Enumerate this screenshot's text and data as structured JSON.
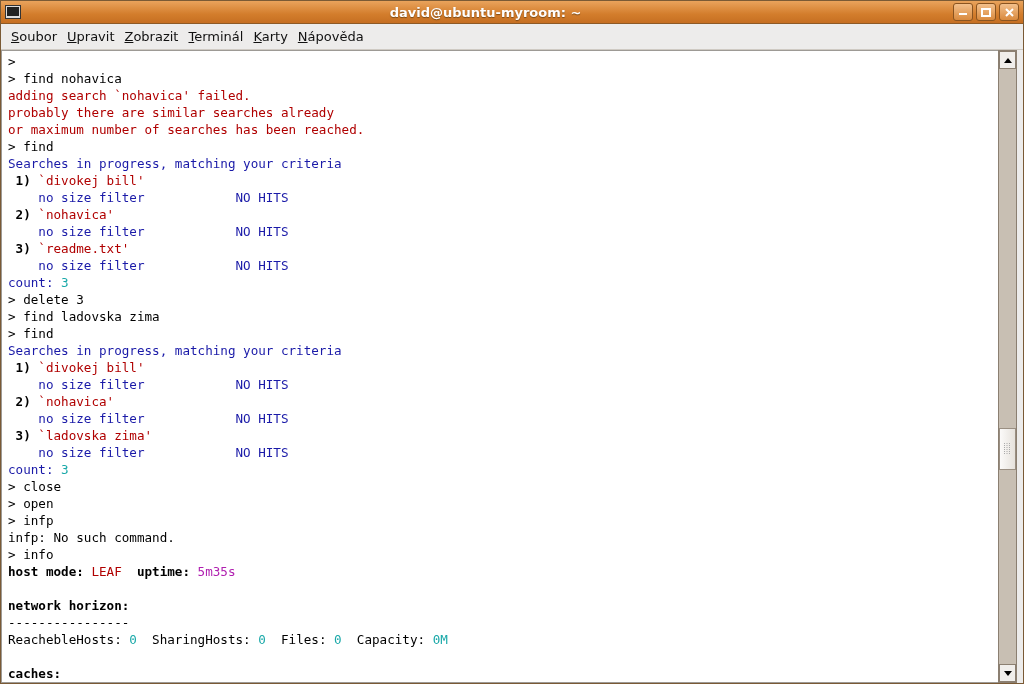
{
  "window": {
    "title": "david@ubuntu-myroom: ~"
  },
  "menu": [
    "Soubor",
    "Upravit",
    "Zobrazit",
    "Terminál",
    "Karty",
    "Nápověda"
  ],
  "terminal": {
    "lines": [
      {
        "kind": "text",
        "segments": [
          {
            "kind": "plain",
            "text": ">"
          }
        ]
      },
      {
        "kind": "text",
        "segments": [
          {
            "kind": "plain",
            "text": "> find nohavica"
          }
        ]
      },
      {
        "kind": "text",
        "segments": [
          {
            "kind": "error",
            "text": "adding search `nohavica' failed."
          }
        ]
      },
      {
        "kind": "text",
        "segments": [
          {
            "kind": "error",
            "text": "probably there are similar searches already"
          }
        ]
      },
      {
        "kind": "text",
        "segments": [
          {
            "kind": "error",
            "text": "or maximum number of searches has been reached."
          }
        ]
      },
      {
        "kind": "text",
        "segments": [
          {
            "kind": "plain",
            "text": "> find"
          }
        ]
      },
      {
        "kind": "text",
        "segments": [
          {
            "kind": "info",
            "text": "Searches in progress, matching your criteria"
          }
        ]
      },
      {
        "kind": "text",
        "segments": [
          {
            "kind": "bold",
            "text": " 1) "
          },
          {
            "kind": "error",
            "text": "`divokej bill'"
          }
        ]
      },
      {
        "kind": "text",
        "segments": [
          {
            "kind": "info",
            "text": "    no size filter            NO HITS"
          }
        ]
      },
      {
        "kind": "text",
        "segments": [
          {
            "kind": "bold",
            "text": " 2) "
          },
          {
            "kind": "error",
            "text": "`nohavica'"
          }
        ]
      },
      {
        "kind": "text",
        "segments": [
          {
            "kind": "info",
            "text": "    no size filter            NO HITS"
          }
        ]
      },
      {
        "kind": "text",
        "segments": [
          {
            "kind": "bold",
            "text": " 3) "
          },
          {
            "kind": "error",
            "text": "`readme.txt'"
          }
        ]
      },
      {
        "kind": "text",
        "segments": [
          {
            "kind": "info",
            "text": "    no size filter            NO HITS"
          }
        ]
      },
      {
        "kind": "text",
        "segments": [
          {
            "kind": "info",
            "text": "count: "
          },
          {
            "kind": "number",
            "text": "3"
          }
        ]
      },
      {
        "kind": "text",
        "segments": [
          {
            "kind": "plain",
            "text": "> delete 3"
          }
        ]
      },
      {
        "kind": "text",
        "segments": [
          {
            "kind": "plain",
            "text": "> find ladovska zima"
          }
        ]
      },
      {
        "kind": "text",
        "segments": [
          {
            "kind": "plain",
            "text": "> find"
          }
        ]
      },
      {
        "kind": "text",
        "segments": [
          {
            "kind": "info",
            "text": "Searches in progress, matching your criteria"
          }
        ]
      },
      {
        "kind": "text",
        "segments": [
          {
            "kind": "bold",
            "text": " 1) "
          },
          {
            "kind": "error",
            "text": "`divokej bill'"
          }
        ]
      },
      {
        "kind": "text",
        "segments": [
          {
            "kind": "info",
            "text": "    no size filter            NO HITS"
          }
        ]
      },
      {
        "kind": "text",
        "segments": [
          {
            "kind": "bold",
            "text": " 2) "
          },
          {
            "kind": "error",
            "text": "`nohavica'"
          }
        ]
      },
      {
        "kind": "text",
        "segments": [
          {
            "kind": "info",
            "text": "    no size filter            NO HITS"
          }
        ]
      },
      {
        "kind": "text",
        "segments": [
          {
            "kind": "bold",
            "text": " 3) "
          },
          {
            "kind": "error",
            "text": "`ladovska zima'"
          }
        ]
      },
      {
        "kind": "text",
        "segments": [
          {
            "kind": "info",
            "text": "    no size filter            NO HITS"
          }
        ]
      },
      {
        "kind": "text",
        "segments": [
          {
            "kind": "info",
            "text": "count: "
          },
          {
            "kind": "number",
            "text": "3"
          }
        ]
      },
      {
        "kind": "text",
        "segments": [
          {
            "kind": "plain",
            "text": "> close"
          }
        ]
      },
      {
        "kind": "text",
        "segments": [
          {
            "kind": "plain",
            "text": "> open"
          }
        ]
      },
      {
        "kind": "text",
        "segments": [
          {
            "kind": "plain",
            "text": "> infp"
          }
        ]
      },
      {
        "kind": "text",
        "segments": [
          {
            "kind": "plain",
            "text": "infp: No such command."
          }
        ]
      },
      {
        "kind": "text",
        "segments": [
          {
            "kind": "plain",
            "text": "> info"
          }
        ]
      },
      {
        "kind": "text",
        "segments": [
          {
            "kind": "bold",
            "text": "host mode: "
          },
          {
            "kind": "error",
            "text": "LEAF"
          },
          {
            "kind": "bold",
            "text": "  uptime: "
          },
          {
            "kind": "magenta",
            "text": "5m35s"
          }
        ]
      },
      {
        "kind": "blank"
      },
      {
        "kind": "text",
        "segments": [
          {
            "kind": "bold",
            "text": "network horizon:"
          }
        ]
      },
      {
        "kind": "text",
        "segments": [
          {
            "kind": "plain",
            "text": "----------------"
          }
        ]
      },
      {
        "kind": "text",
        "segments": [
          {
            "kind": "plain",
            "text": "ReachebleHosts: "
          },
          {
            "kind": "number",
            "text": "0"
          },
          {
            "kind": "plain",
            "text": "  SharingHosts: "
          },
          {
            "kind": "number",
            "text": "0"
          },
          {
            "kind": "plain",
            "text": "  Files: "
          },
          {
            "kind": "number",
            "text": "0"
          },
          {
            "kind": "plain",
            "text": "  Capacity: "
          },
          {
            "kind": "number",
            "text": "0M"
          }
        ]
      },
      {
        "kind": "blank"
      },
      {
        "kind": "text",
        "segments": [
          {
            "kind": "bold",
            "text": "caches:"
          }
        ]
      }
    ]
  }
}
